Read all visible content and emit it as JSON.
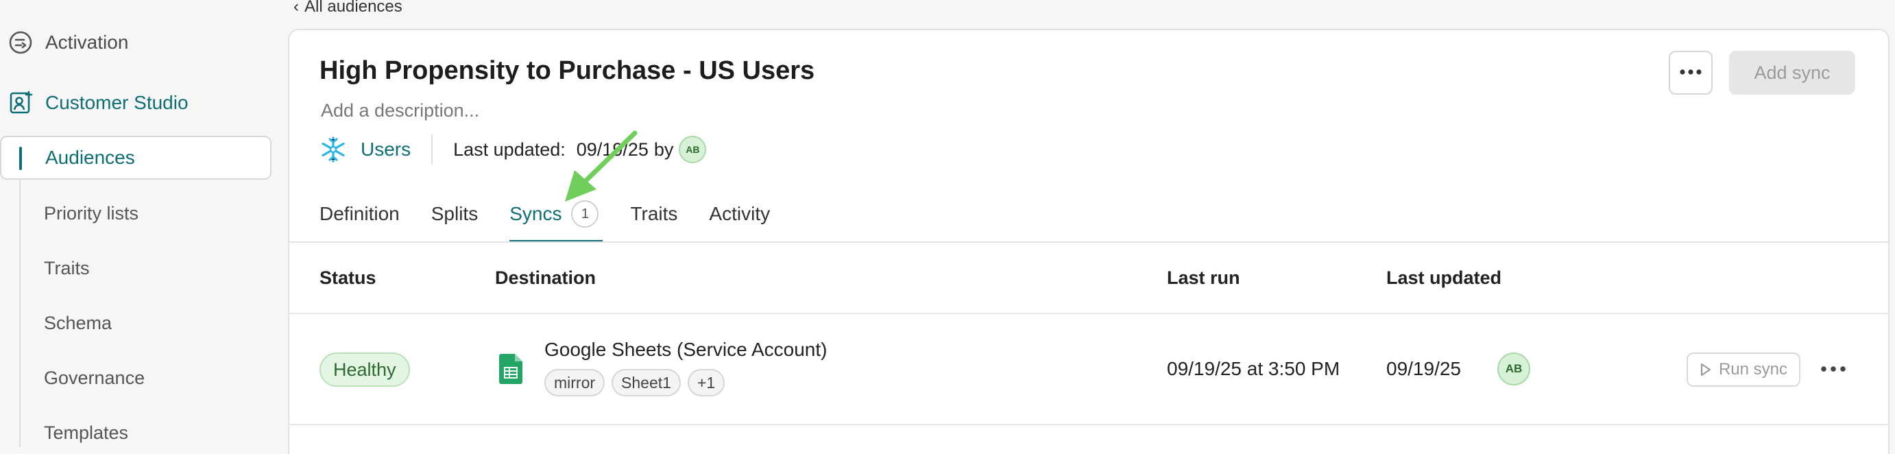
{
  "sidebar": {
    "activation": {
      "label": "Activation",
      "icon": "activation-icon"
    },
    "customer_studio": {
      "label": "Customer Studio",
      "icon": "customer-studio-icon"
    },
    "items": [
      {
        "label": "Audiences",
        "active": true
      },
      {
        "label": "Priority lists"
      },
      {
        "label": "Traits"
      },
      {
        "label": "Schema"
      },
      {
        "label": "Governance"
      },
      {
        "label": "Templates"
      }
    ]
  },
  "breadcrumb": {
    "label": "All audiences",
    "icon": "chevron-left-icon"
  },
  "header": {
    "title": "High Propensity to Purchase - US Users",
    "description_placeholder": "Add a description...",
    "source": {
      "label": "Users",
      "icon": "snowflake-icon"
    },
    "last_updated_label": "Last updated:",
    "last_updated_date": "09/19/25",
    "by_label": "by",
    "avatar_initials": "AB",
    "more_button_icon": "more-horizontal-icon",
    "add_sync_label": "Add sync"
  },
  "tabs": [
    {
      "label": "Definition"
    },
    {
      "label": "Splits"
    },
    {
      "label": "Syncs",
      "count": "1",
      "active": true
    },
    {
      "label": "Traits"
    },
    {
      "label": "Activity"
    }
  ],
  "table": {
    "headers": {
      "status": "Status",
      "destination": "Destination",
      "last_run": "Last run",
      "last_updated": "Last updated"
    },
    "rows": [
      {
        "status": "Healthy",
        "destination_icon": "google-sheets-icon",
        "destination_name": "Google Sheets (Service Account)",
        "tags": [
          "mirror",
          "Sheet1",
          "+1"
        ],
        "last_run": "09/19/25 at 3:50 PM",
        "last_updated": "09/19/25",
        "avatar_initials": "AB",
        "run_sync_label": "Run sync"
      }
    ]
  },
  "colors": {
    "accent": "#0e6e76",
    "healthy_bg": "#e3f5e3",
    "annotation_arrow": "#6fcf5a"
  }
}
